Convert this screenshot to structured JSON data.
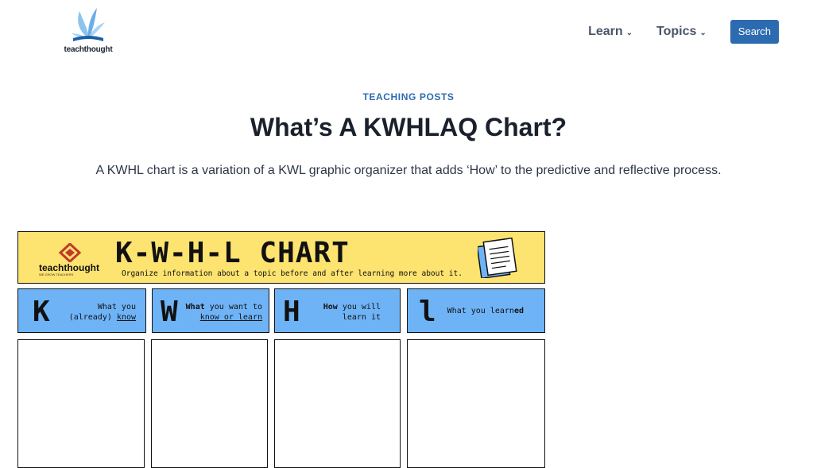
{
  "header": {
    "logo_text": "teachthought",
    "nav": [
      {
        "label": "Learn"
      },
      {
        "label": "Topics"
      }
    ],
    "search_label": "Search"
  },
  "article": {
    "category": "TEACHING POSTS",
    "title": "What’s A KWHLAQ Chart?",
    "excerpt": "A KWHL chart is a variation of a KWL graphic organizer that adds ‘How’ to the predictive and reflective process."
  },
  "chart_image": {
    "logo_text": "teachthought",
    "logo_tagline": "WE GROW TEACHERS",
    "title": "K-W-H-L CHART",
    "subtitle": "Organize information about a topic before and after learning more about it.",
    "columns": [
      {
        "letter": "K",
        "line1_plain": "What you",
        "line2_plain": "(already) ",
        "line2_u": "know"
      },
      {
        "letter": "W",
        "line1_bold": "What",
        "line1_plain": " you want to",
        "line2_u": "know or learn"
      },
      {
        "letter": "H",
        "line1_bold": "How",
        "line1_plain": " you will",
        "line2_plain": "learn it"
      },
      {
        "letter": "l",
        "line1_plain": "What you learn",
        "line1_bold": "ed"
      }
    ]
  },
  "colors": {
    "accent": "#2d6bb0",
    "banner": "#fde36f",
    "column_header": "#6fb3f7"
  }
}
